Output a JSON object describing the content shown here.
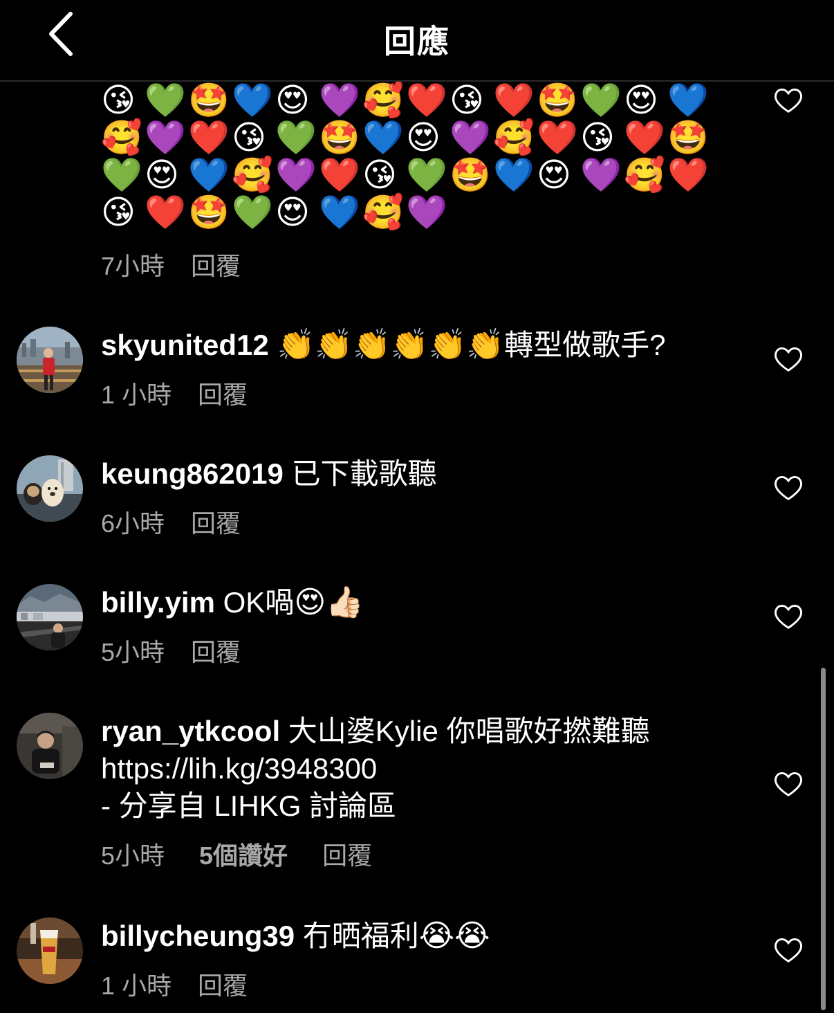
{
  "header": {
    "title": "回應"
  },
  "first_comment": {
    "emojis": [
      "😘",
      "💚",
      "🤩",
      "💙",
      "😍",
      "💜",
      "🥰",
      "❤️",
      "😘",
      "❤️",
      "🤩",
      "💚",
      "😍",
      "💙",
      "🥰",
      "💜",
      "❤️",
      "😘",
      "💚",
      "🤩",
      "💙",
      "😍",
      "💜",
      "🥰",
      "❤️",
      "😘",
      "❤️",
      "🤩",
      "💚",
      "😍",
      "💙",
      "🥰",
      "💜",
      "❤️",
      "😘",
      "💚",
      "🤩",
      "💙",
      "😍",
      "💜",
      "🥰",
      "❤️",
      "😘",
      "❤️",
      "🤩",
      "💚",
      "😍",
      "💙",
      "🥰",
      "💜"
    ],
    "time": "7小時",
    "reply": "回覆"
  },
  "comments": [
    {
      "username": "skyunited12",
      "emojis": "👏👏👏👏👏👏",
      "text": "轉型做歌手?",
      "time": "1 小時",
      "reply": "回覆"
    },
    {
      "username": "keung862019",
      "text": "已下載歌聽",
      "time": "6小時",
      "reply": "回覆"
    },
    {
      "username": "billy.yim",
      "text": "OK喎",
      "emojis": "😍👍🏻",
      "time": "5小時",
      "reply": "回覆"
    },
    {
      "username": "ryan_ytkcool",
      "text": "大山婆Kylie 你唱歌好撚難聽",
      "line2": "https://lih.kg/3948300",
      "line3": "- 分享自 LIHKG 討論區",
      "time": "5小時",
      "likes": "5個讚好",
      "reply": "回覆"
    },
    {
      "username": "billycheung39",
      "text": "冇晒福利",
      "emojis": "😭😭",
      "time": "1 小時",
      "reply": "回覆"
    }
  ]
}
